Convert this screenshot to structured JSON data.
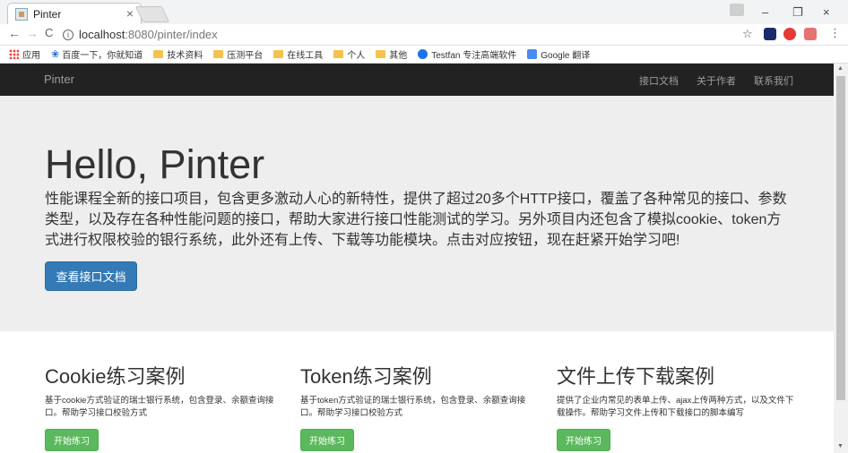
{
  "browser": {
    "tab_title": "Pinter",
    "tab_close": "×",
    "window_min": "–",
    "window_max": "❐",
    "window_close": "×",
    "back": "←",
    "forward": "→",
    "reload": "C",
    "url_host": "localhost",
    "url_path": ":8080/pinter/index",
    "menu": "⋮"
  },
  "bookmarks": [
    {
      "label": "应用",
      "icon": "apps-grid-icon"
    },
    {
      "label": "百度一下，你就知道",
      "icon": "baidu-paw-icon"
    },
    {
      "label": "技术资料",
      "icon": "folder-icon"
    },
    {
      "label": "压测平台",
      "icon": "folder-icon"
    },
    {
      "label": "在线工具",
      "icon": "folder-icon"
    },
    {
      "label": "个人",
      "icon": "folder-icon"
    },
    {
      "label": "其他",
      "icon": "folder-icon"
    },
    {
      "label": "Testfan 专注高端软件",
      "icon": "globe-icon"
    },
    {
      "label": "Google 翻译",
      "icon": "translate-icon"
    }
  ],
  "navbar": {
    "brand": "Pinter",
    "links": [
      "接口文档",
      "关于作者",
      "联系我们"
    ]
  },
  "jumbotron": {
    "title": "Hello, Pinter",
    "text": "性能课程全新的接口项目，包含更多激动人心的新特性，提供了超过20多个HTTP接口，覆盖了各种常见的接口、参数类型，以及存在各种性能问题的接口，帮助大家进行接口性能测试的学习。另外项目内还包含了模拟cookie、token方式进行权限校验的银行系统，此外还有上传、下载等功能模块。点击对应按钮，现在赶紧开始学习吧!",
    "button": "查看接口文档"
  },
  "cards": [
    {
      "title": "Cookie练习案例",
      "text": "基于cookie方式验证的瑞士银行系统，包含登录、余额查询接口。帮助学习接口校验方式",
      "button": "开始练习"
    },
    {
      "title": "Token练习案例",
      "text": "基于token方式验证的瑞士银行系统，包含登录、余额查询接口。帮助学习接口校验方式",
      "button": "开始练习"
    },
    {
      "title": "文件上传下载案例",
      "text": "提供了企业内常见的表单上传、ajax上传两种方式，以及文件下载操作。帮助学习文件上传和下载接口的脚本编写",
      "button": "开始练习"
    }
  ],
  "colors": {
    "navbar_bg": "#222222",
    "jumbotron_bg": "#eeeeee",
    "primary_button": "#337ab7",
    "success_button": "#5cb85c"
  }
}
